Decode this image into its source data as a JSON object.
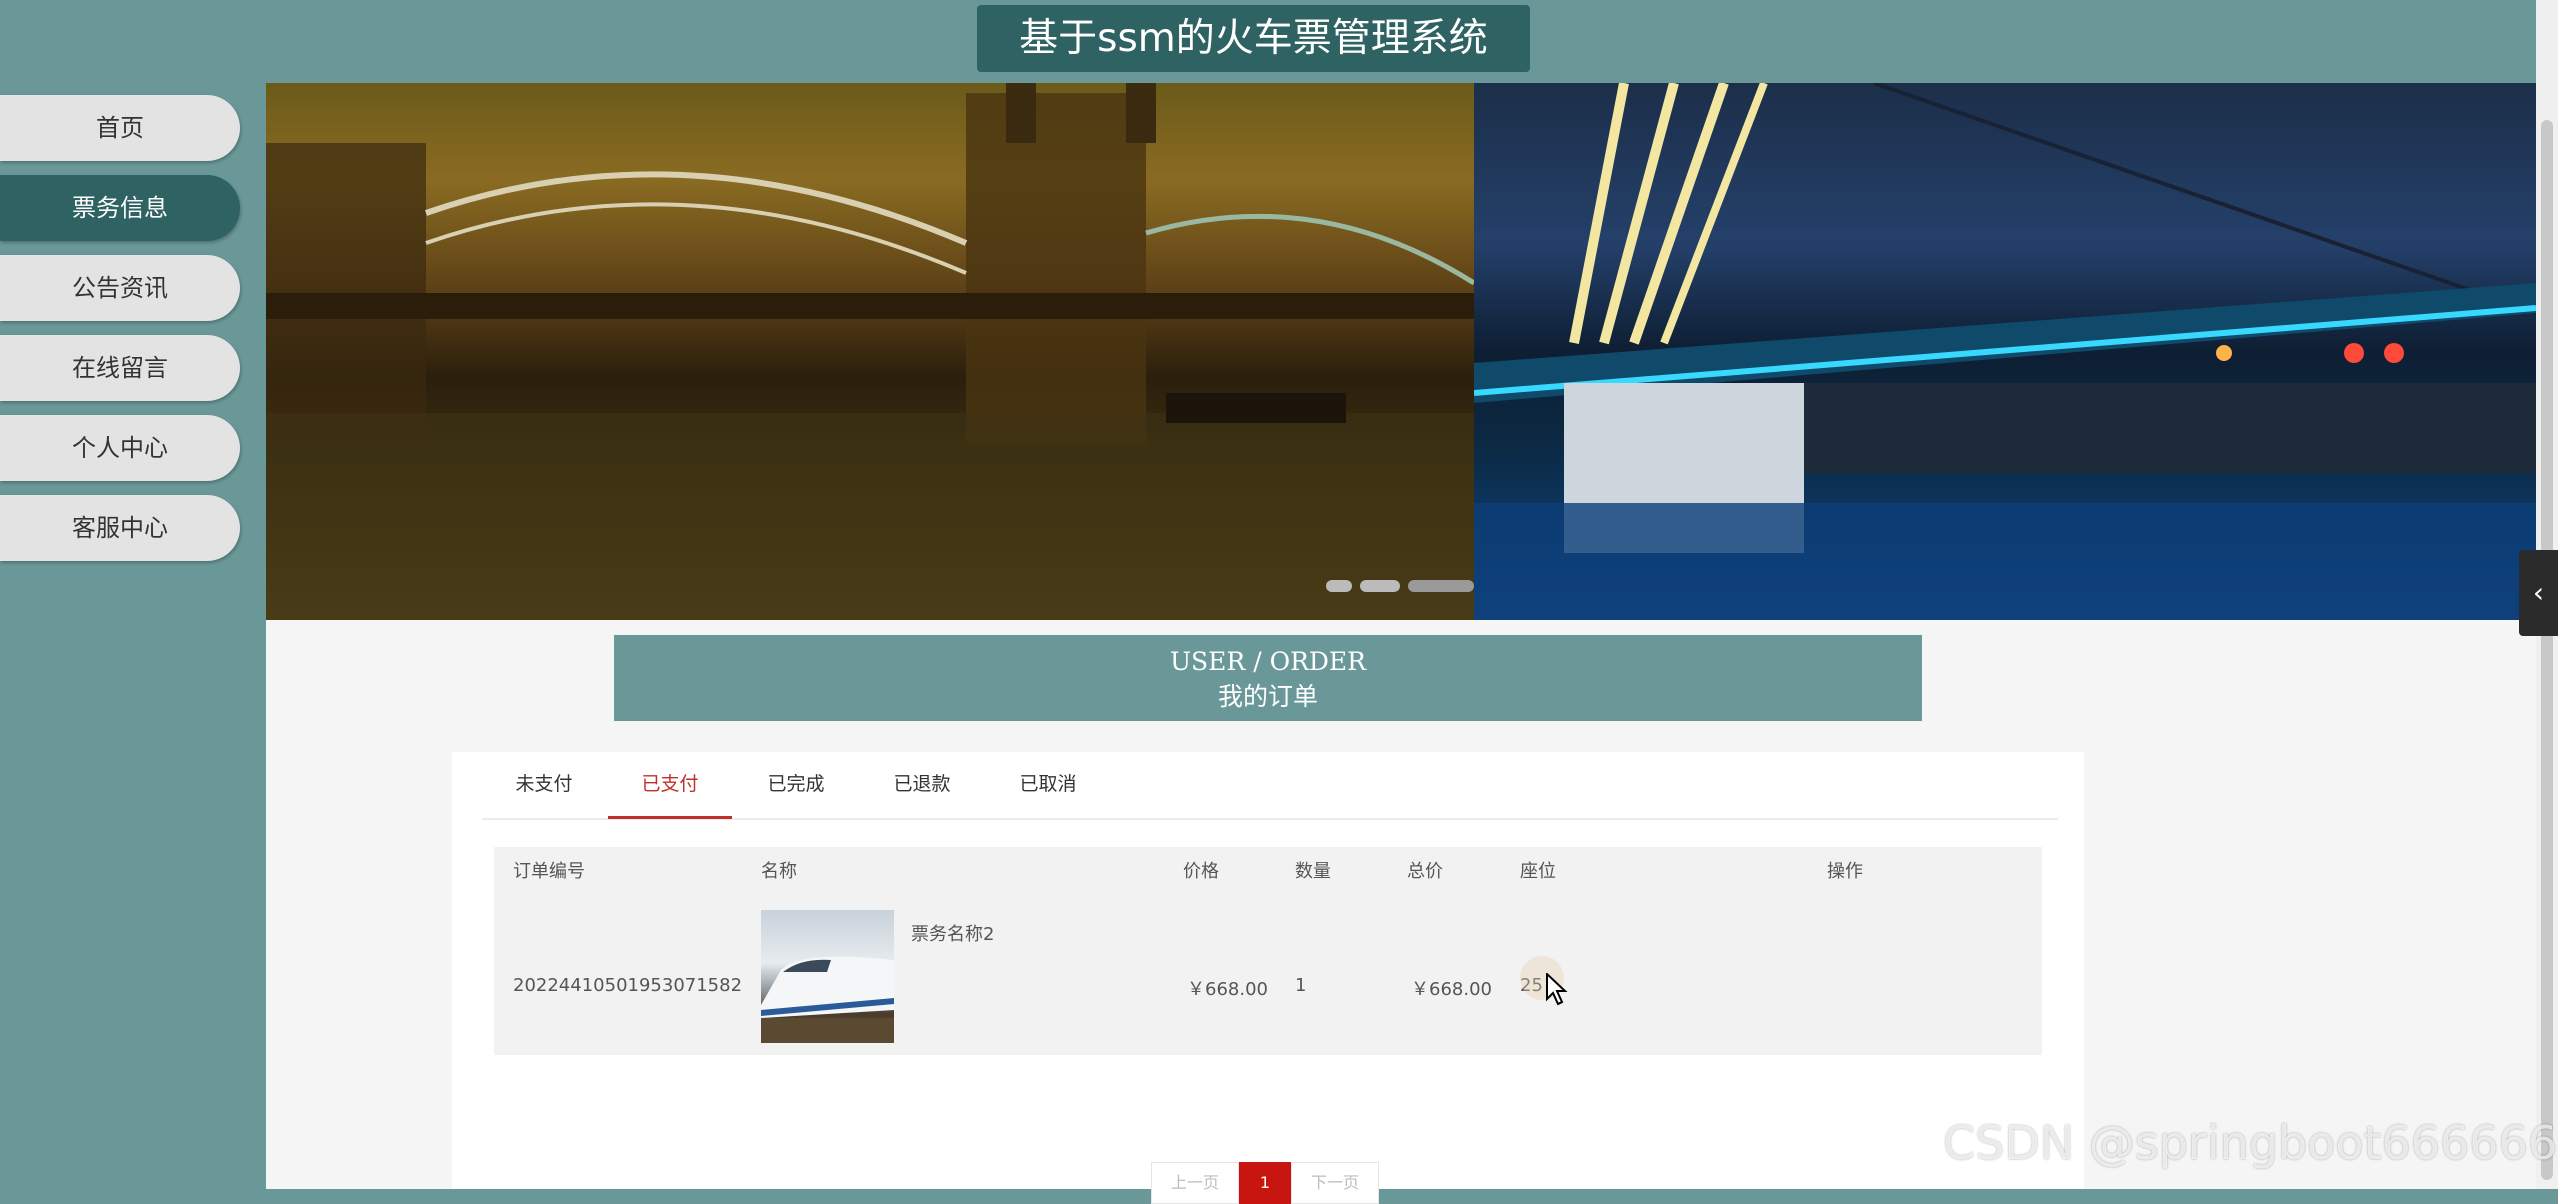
{
  "site": {
    "title": "基于ssm的火车票管理系统"
  },
  "sidebar": {
    "items": [
      {
        "label": "首页",
        "active": false
      },
      {
        "label": "票务信息",
        "active": true
      },
      {
        "label": "公告资讯",
        "active": false
      },
      {
        "label": "在线留言",
        "active": false
      },
      {
        "label": "个人中心",
        "active": false
      },
      {
        "label": "客服中心",
        "active": false
      }
    ]
  },
  "banner": {
    "slides_count": 3,
    "active_slide": 3
  },
  "section": {
    "title_en": "USER / ORDER",
    "title_cn": "我的订单"
  },
  "tabs": [
    {
      "label": "未支付",
      "active": false
    },
    {
      "label": "已支付",
      "active": true
    },
    {
      "label": "已完成",
      "active": false
    },
    {
      "label": "已退款",
      "active": false
    },
    {
      "label": "已取消",
      "active": false
    }
  ],
  "table": {
    "headers": [
      "订单编号",
      "名称",
      "价格",
      "数量",
      "总价",
      "座位",
      "操作"
    ],
    "rows": [
      {
        "order_no": "20224410501953071582",
        "name": "票务名称2",
        "price": "￥668.00",
        "quantity": "1",
        "total": "￥668.00",
        "seat": "25",
        "action": ""
      }
    ]
  },
  "pagination": {
    "prev": "上一页",
    "current": "1",
    "next": "下一页"
  },
  "colors": {
    "teal": "#6a9898",
    "dark_teal": "#2f6262",
    "accent_red": "#c8150f"
  },
  "watermark": "CSDN @springboot666666"
}
